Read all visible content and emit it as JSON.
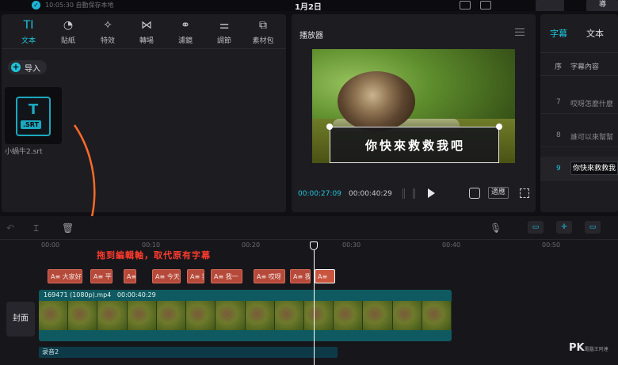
{
  "topbar": {
    "saved_status": "10:05:30 自動保存本地",
    "project_title": "1月2日"
  },
  "media_tabs": [
    {
      "icon": "TI",
      "label": "文本",
      "active": true
    },
    {
      "icon": "◔",
      "label": "貼紙",
      "active": false
    },
    {
      "icon": "✧",
      "label": "特效",
      "active": false
    },
    {
      "icon": "⋈",
      "label": "轉場",
      "active": false
    },
    {
      "icon": "⚭",
      "label": "濾鏡",
      "active": false
    },
    {
      "icon": "⚌",
      "label": "調節",
      "active": false
    },
    {
      "icon": "⧉",
      "label": "素材包",
      "active": false
    }
  ],
  "import": {
    "label": "导入"
  },
  "media_item": {
    "badge": ".SRT",
    "name": "小蝸牛2.srt"
  },
  "player": {
    "title": "播放器",
    "subtitle_overlay": "你快來救救我吧",
    "current_time": "00:00:27:09",
    "total_time": "00:00:40:29",
    "ratio_label": "適應"
  },
  "subtitles_panel": {
    "tabs": [
      "字幕",
      "文本"
    ],
    "col_index": "序",
    "col_content": "字幕內容",
    "rows": [
      {
        "n": "7",
        "text": "哎呀怎麼什麼",
        "active": false
      },
      {
        "n": "8",
        "text": "誰可以來幫幫",
        "active": false
      },
      {
        "n": "9",
        "text": "你快來救救我",
        "active": true
      }
    ]
  },
  "timeline": {
    "ruler": [
      "00:00",
      "00:10",
      "00:20",
      "00:30",
      "00:40",
      "00:50"
    ],
    "hint": "拖到編輯軸，取代原有字幕",
    "sub_clips": [
      "A≡ 大家好",
      "A≡ 平",
      "A≡",
      "A≡ 今天",
      "A≡ 我",
      "A≡ 我一",
      "A≡ 哎呀",
      "A≡ 我",
      "A≡"
    ],
    "cover_label": "封面",
    "video_clip": {
      "filename": "169471 (1080p).mp4",
      "duration": "00:00:40:29"
    },
    "audio_clip": {
      "name": "录音2"
    }
  },
  "watermark": {
    "main": "PK",
    "small": "電腦王阿達"
  }
}
